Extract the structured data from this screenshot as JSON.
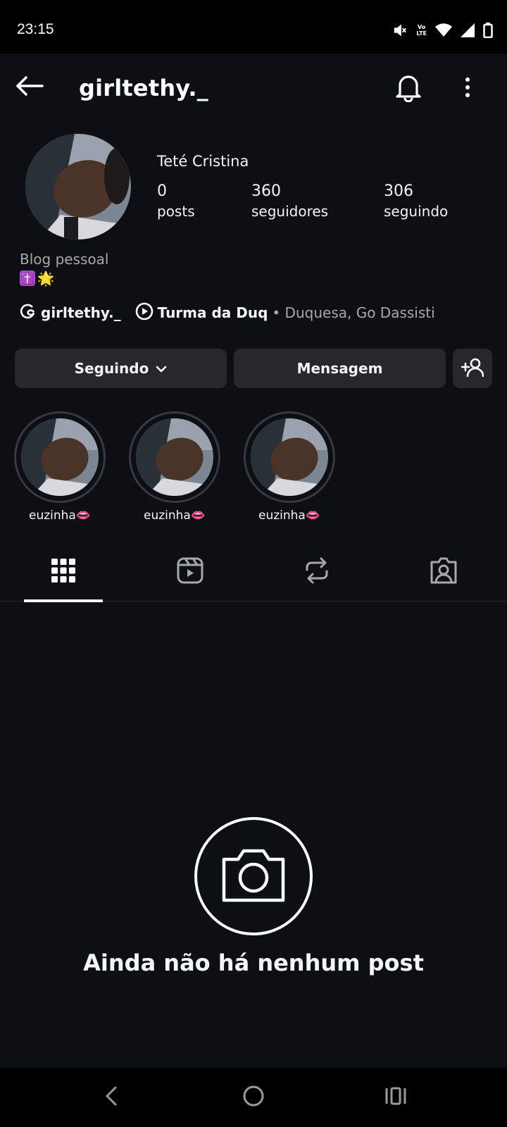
{
  "status_bar": {
    "time": "23:15",
    "volte_top": "Vo",
    "volte_bottom": "LTE",
    "icons": [
      "mute-icon",
      "volte-icon",
      "wifi-icon",
      "signal-icon",
      "battery-icon"
    ]
  },
  "header": {
    "username": "girltethy._",
    "icons": [
      "back-arrow-icon",
      "bell-icon",
      "more-vertical-icon"
    ]
  },
  "profile": {
    "display_name": "Teté Cristina",
    "stats": [
      {
        "value": "0",
        "label": "posts"
      },
      {
        "value": "360",
        "label": "seguidores"
      },
      {
        "value": "306",
        "label": "seguindo"
      }
    ],
    "bio_category": "Blog pessoal",
    "bio_emojis": [
      "✝️",
      "🌟"
    ],
    "threads_handle": "girltethy._",
    "music_title": "Turma da Duq",
    "music_artists": "• Duquesa, Go Dassisti"
  },
  "actions": {
    "following_label": "Seguindo",
    "message_label": "Mensagem"
  },
  "highlights": [
    {
      "label": "euzinha👄"
    },
    {
      "label": "euzinha👄"
    },
    {
      "label": "euzinha👄"
    }
  ],
  "tabs": [
    "grid-icon",
    "reels-icon",
    "reposts-icon",
    "tagged-icon"
  ],
  "empty_state": {
    "message": "Ainda não há nenhum post"
  },
  "colors": {
    "background": "#0c1014",
    "button": "#25292e",
    "secondary_text": "#a8a8a8"
  }
}
